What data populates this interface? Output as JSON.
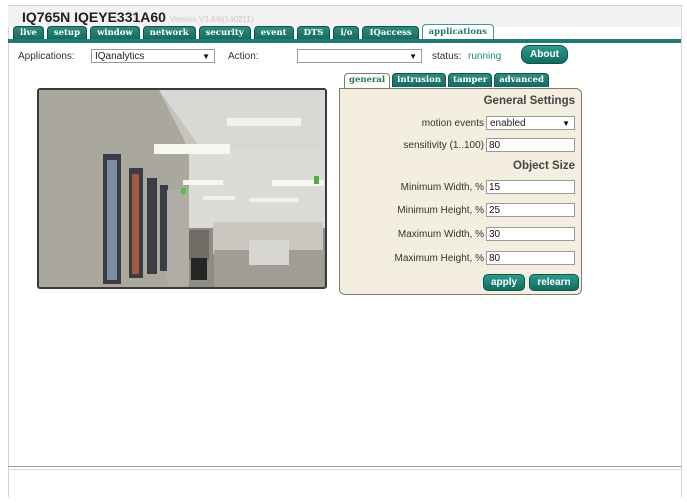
{
  "header": {
    "model": "IQ765N IQEYE331A60",
    "version": "Version V3.6/6(140211)"
  },
  "tabs": [
    {
      "label": "live"
    },
    {
      "label": "setup"
    },
    {
      "label": "window"
    },
    {
      "label": "network"
    },
    {
      "label": "security"
    },
    {
      "label": "event"
    },
    {
      "label": "DTS"
    },
    {
      "label": "i/o"
    },
    {
      "label": "IQaccess"
    },
    {
      "label": "applications",
      "active": true
    }
  ],
  "toolbar": {
    "applications_label": "Applications:",
    "applications_value": "IQanalytics",
    "action_label": "Action:",
    "action_value": "",
    "status_label": "status:",
    "status_value": "running",
    "about_label": "About"
  },
  "subtabs": [
    {
      "label": "general",
      "active": true
    },
    {
      "label": "intrusion"
    },
    {
      "label": "tamper"
    },
    {
      "label": "advanced"
    }
  ],
  "panel": {
    "general_heading": "General Settings",
    "motion_events_label": "motion events",
    "motion_events_value": "enabled",
    "sensitivity_label": "sensitivity (1..100)",
    "sensitivity_value": "80",
    "object_size_heading": "Object Size",
    "min_width_label": "Minimum Width, %",
    "min_width_value": "15",
    "min_height_label": "Minimum Height, %",
    "min_height_value": "25",
    "max_width_label": "Maximum Width, %",
    "max_width_value": "30",
    "max_height_label": "Maximum Height, %",
    "max_height_value": "80",
    "apply_label": "apply",
    "relearn_label": "relearn"
  },
  "colors": {
    "tab_accent": "#1f7b71",
    "status_running": "#1c8a7c",
    "panel_background": "#f3eedf"
  }
}
